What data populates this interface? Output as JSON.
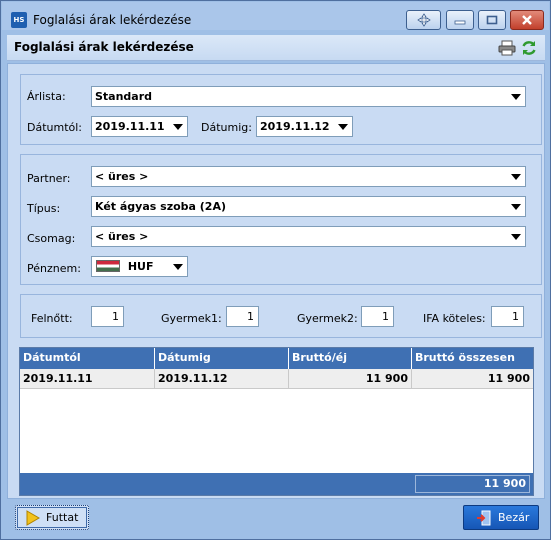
{
  "window": {
    "title": "Foglalási árak lekérdezése",
    "app_icon_text": "HS"
  },
  "header": {
    "title": "Foglalási árak lekérdezése"
  },
  "pricelist": {
    "label": "Árlista:",
    "value": "Standard",
    "from_label": "Dátumtól:",
    "from_value": "2019.11.11",
    "to_label": "Dátumig:",
    "to_value": "2019.11.12"
  },
  "filters": {
    "partner_label": "Partner:",
    "partner_value": "< üres >",
    "type_label": "Típus:",
    "type_value": "Két ágyas szoba (2A)",
    "package_label": "Csomag:",
    "package_value": "< üres >",
    "currency_label": "Pénznem:",
    "currency_value": "HUF"
  },
  "guests": {
    "adult_label": "Felnőtt:",
    "adult_value": "1",
    "child1_label": "Gyermek1:",
    "child1_value": "1",
    "child2_label": "Gyermek2:",
    "child2_value": "1",
    "vat_label": "IFA köteles:",
    "vat_value": "1"
  },
  "grid": {
    "columns": [
      "Dátumtól",
      "Dátumig",
      "Bruttó/éj",
      "Bruttó összesen"
    ],
    "rows": [
      [
        "2019.11.11",
        "2019.11.12",
        "11 900",
        "11 900"
      ]
    ],
    "total": "11 900"
  },
  "footer": {
    "run_label": "Futtat",
    "close_label": "Bezár"
  },
  "colors": {
    "header_bar": "#3f70b3",
    "panel": "#c9dbf3",
    "window": "#9fbfe6"
  }
}
